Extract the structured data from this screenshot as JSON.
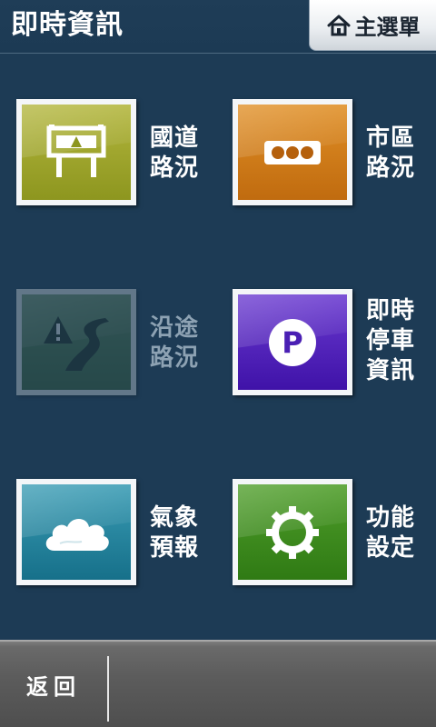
{
  "header": {
    "title": "即時資訊",
    "main_menu_label": "主選單",
    "main_menu_icon": "home-icon"
  },
  "tiles": [
    {
      "id": "national-highway",
      "line1": "國道",
      "line2": "路況",
      "line3": "",
      "icon": "highway-sign-icon",
      "color": "#9aa12b",
      "enabled": true
    },
    {
      "id": "city-traffic",
      "line1": "市區",
      "line2": "路況",
      "line3": "",
      "icon": "traffic-light-icon",
      "color": "#cf7a16",
      "enabled": true
    },
    {
      "id": "route-traffic",
      "line1": "沿途",
      "line2": "路況",
      "line3": "",
      "icon": "winding-road-icon",
      "color": "#3e6a3a",
      "enabled": false
    },
    {
      "id": "parking-info",
      "line1": "即時",
      "line2": "停車",
      "line3": "資訊",
      "icon": "parking-icon",
      "color": "#4a1fb4",
      "enabled": true
    },
    {
      "id": "weather-forecast",
      "line1": "氣象",
      "line2": "預報",
      "line3": "",
      "icon": "cloud-icon",
      "color": "#1f7f97",
      "enabled": true
    },
    {
      "id": "settings",
      "line1": "功能",
      "line2": "設定",
      "line3": "",
      "icon": "gear-icon",
      "color": "#3e8a1d",
      "enabled": true
    }
  ],
  "bottom_bar": {
    "back_label": "返回"
  }
}
